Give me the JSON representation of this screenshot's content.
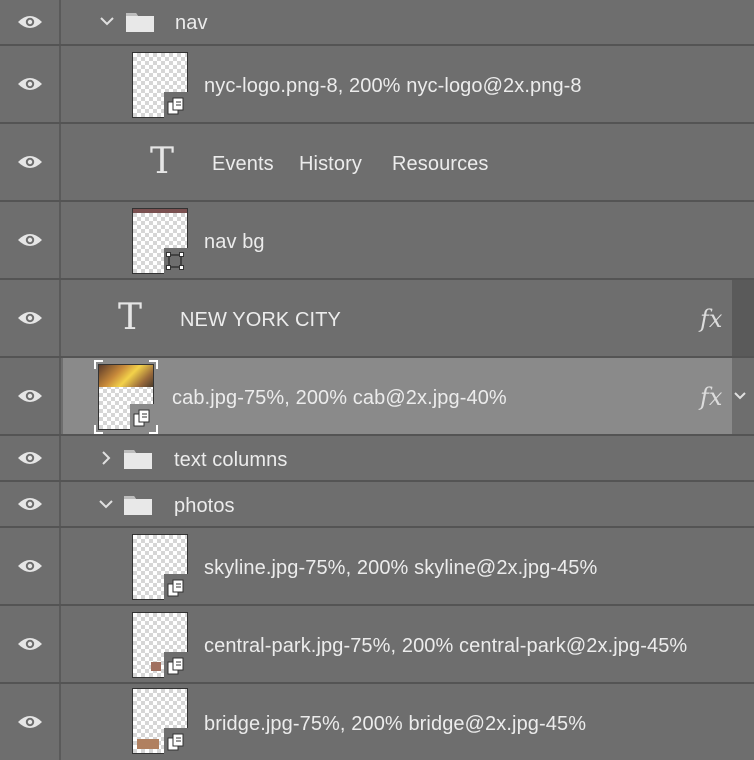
{
  "colors": {
    "panel_bg": "#6e6e6e",
    "selected_row_bg": "#8a8a8a",
    "divider": "#545454",
    "text": "#ececec"
  },
  "layers": [
    {
      "kind": "group",
      "name": "nav",
      "expanded": true,
      "icon": "folder-icon"
    },
    {
      "kind": "smart-object",
      "name": "nyc-logo.png-8, 200% nyc-logo@2x.png-8",
      "icon": "smart-object-badge-icon"
    },
    {
      "kind": "text-group",
      "words": [
        "Events",
        "History",
        "Resources"
      ],
      "icon": "text-layer-icon"
    },
    {
      "kind": "shape",
      "name": "nav bg",
      "icon": "vector-shape-badge-icon"
    },
    {
      "kind": "text",
      "name": "NEW YORK CITY",
      "icon": "text-layer-icon",
      "fx": "fx"
    },
    {
      "kind": "smart-object",
      "name": "cab.jpg-75%, 200% cab@2x.jpg-40%",
      "selected": true,
      "fx": "fx"
    },
    {
      "kind": "group",
      "name": "text columns",
      "expanded": false,
      "icon": "folder-icon"
    },
    {
      "kind": "group",
      "name": "photos",
      "expanded": true,
      "icon": "folder-icon"
    },
    {
      "kind": "smart-object",
      "name": "skyline.jpg-75%, 200% skyline@2x.jpg-45%"
    },
    {
      "kind": "smart-object",
      "name": "central-park.jpg-75%, 200% central-park@2x.jpg-45%"
    },
    {
      "kind": "smart-object",
      "name": "bridge.jpg-75%, 200% bridge@2x.jpg-45%"
    }
  ]
}
